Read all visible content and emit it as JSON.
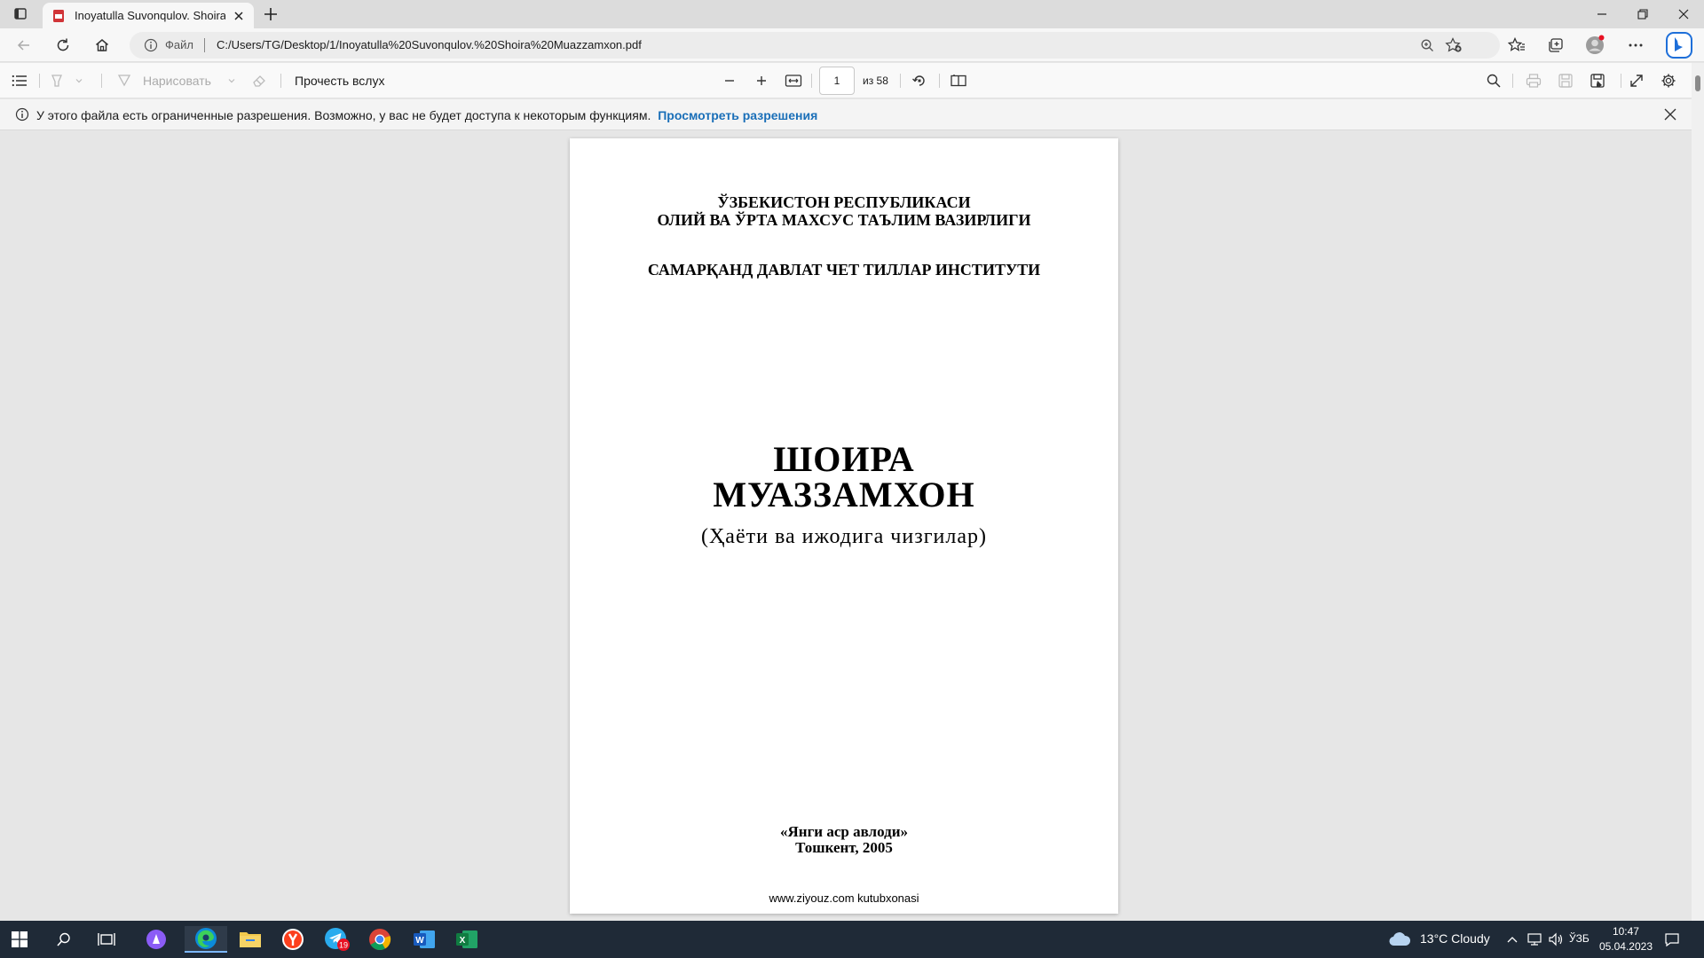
{
  "browser": {
    "tab_title": "Inoyatulla Suvonqulov. Shoira Mu",
    "scheme_label": "Файл",
    "url": "C:/Users/TG/Desktop/1/Inoyatulla%20Suvonqulov.%20Shoira%20Muazzamxon.pdf"
  },
  "pdf_toolbar": {
    "draw_label": "Нарисовать",
    "read_aloud_label": "Прочесть вслух",
    "page_current": "1",
    "page_total": "из 58"
  },
  "banner": {
    "text": "У этого файла есть ограниченные разрешения. Возможно, у вас не будет доступа к некоторым функциям.",
    "link": "Просмотреть разрешения"
  },
  "document": {
    "line1": "ЎЗБЕКИСТОН РЕСПУБЛИКАСИ",
    "line2": "ОЛИЙ ВА ЎРТА МАХСУС ТАЪЛИМ ВАЗИРЛИГИ",
    "line3": "САМАРҚАНД ДАВЛАТ ЧЕТ ТИЛЛАР ИНСТИТУТИ",
    "title1": "ШОИРА",
    "title2": "МУАЗЗАМХОН",
    "subtitle": "(Ҳаёти ва ижодига чизгилар)",
    "publisher": "«Янги аср авлоди»",
    "city_year": "Тошкент, 2005",
    "footer": "www.ziyouz.com kutubxonasi"
  },
  "taskbar": {
    "weather": "13°C  Cloudy",
    "language": "ЎЗБ",
    "time": "10:47",
    "date": "05.04.2023",
    "telegram_badge": "19"
  },
  "colors": {
    "link": "#1a6fb8",
    "taskbar": "#1f2a37",
    "edge_blue": "#1e6fd9"
  }
}
